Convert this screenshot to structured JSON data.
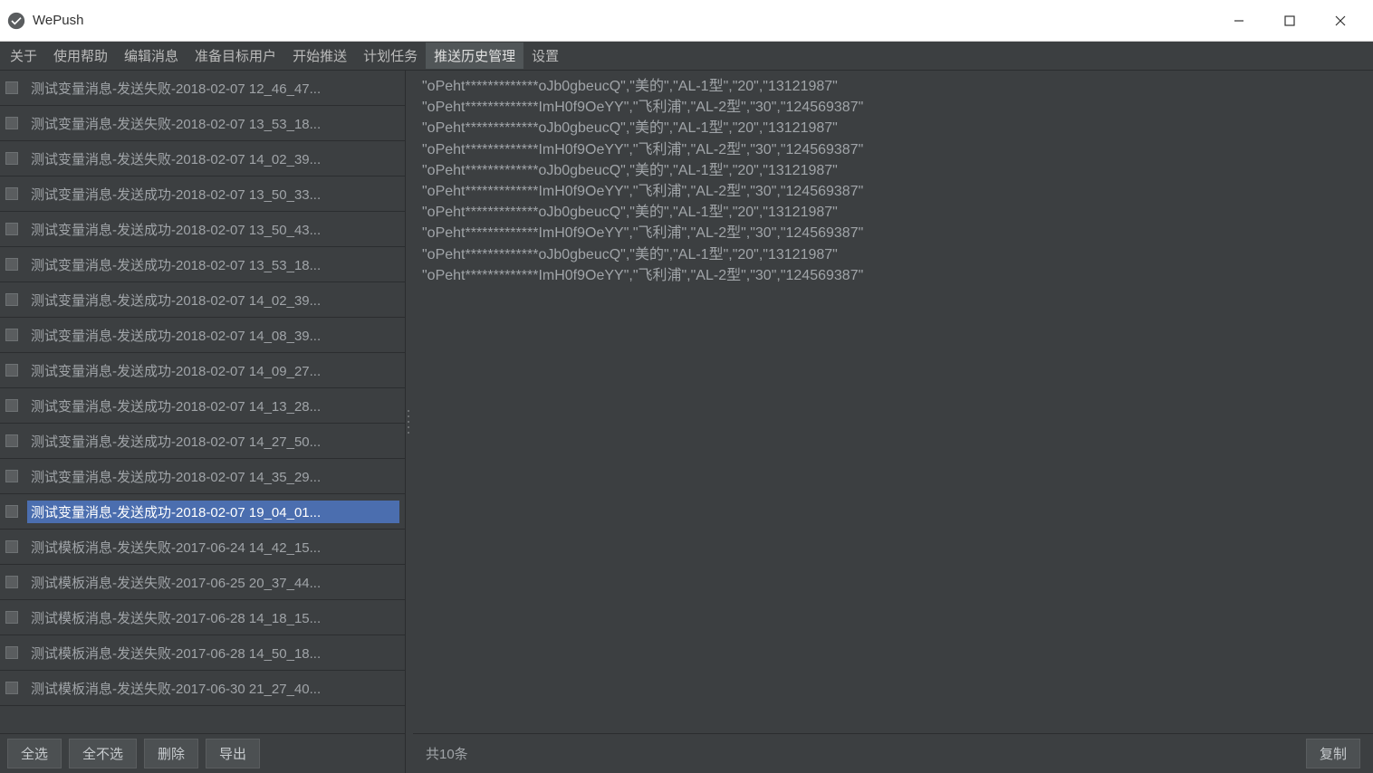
{
  "window": {
    "title": "WePush"
  },
  "menu": {
    "items": [
      {
        "label": "关于",
        "active": false
      },
      {
        "label": "使用帮助",
        "active": false
      },
      {
        "label": "编辑消息",
        "active": false
      },
      {
        "label": "准备目标用户",
        "active": false
      },
      {
        "label": "开始推送",
        "active": false
      },
      {
        "label": "计划任务",
        "active": false
      },
      {
        "label": "推送历史管理",
        "active": true
      },
      {
        "label": "设置",
        "active": false
      }
    ]
  },
  "history": {
    "items": [
      {
        "label": "测试变量消息-发送失败-2018-02-07 12_46_47...",
        "selected": false
      },
      {
        "label": "测试变量消息-发送失败-2018-02-07 13_53_18...",
        "selected": false
      },
      {
        "label": "测试变量消息-发送失败-2018-02-07 14_02_39...",
        "selected": false
      },
      {
        "label": "测试变量消息-发送成功-2018-02-07 13_50_33...",
        "selected": false
      },
      {
        "label": "测试变量消息-发送成功-2018-02-07 13_50_43...",
        "selected": false
      },
      {
        "label": "测试变量消息-发送成功-2018-02-07 13_53_18...",
        "selected": false
      },
      {
        "label": "测试变量消息-发送成功-2018-02-07 14_02_39...",
        "selected": false
      },
      {
        "label": "测试变量消息-发送成功-2018-02-07 14_08_39...",
        "selected": false
      },
      {
        "label": "测试变量消息-发送成功-2018-02-07 14_09_27...",
        "selected": false
      },
      {
        "label": "测试变量消息-发送成功-2018-02-07 14_13_28...",
        "selected": false
      },
      {
        "label": "测试变量消息-发送成功-2018-02-07 14_27_50...",
        "selected": false
      },
      {
        "label": "测试变量消息-发送成功-2018-02-07 14_35_29...",
        "selected": false
      },
      {
        "label": "测试变量消息-发送成功-2018-02-07 19_04_01...",
        "selected": true
      },
      {
        "label": "测试模板消息-发送失败-2017-06-24 14_42_15...",
        "selected": false
      },
      {
        "label": "测试模板消息-发送失败-2017-06-25 20_37_44...",
        "selected": false
      },
      {
        "label": "测试模板消息-发送失败-2017-06-28 14_18_15...",
        "selected": false
      },
      {
        "label": "测试模板消息-发送失败-2017-06-28 14_50_18...",
        "selected": false
      },
      {
        "label": "测试模板消息-发送失败-2017-06-30 21_27_40...",
        "selected": false
      }
    ]
  },
  "leftToolbar": {
    "selectAll": "全选",
    "selectNone": "全不选",
    "delete": "删除",
    "export": "导出"
  },
  "content": {
    "lines": [
      "\"oPeht*************oJb0gbeucQ\",\"美的\",\"AL-1型\",\"20\",\"13121987\"",
      "\"oPeht*************ImH0f9OeYY\",\"飞利浦\",\"AL-2型\",\"30\",\"124569387\"",
      "\"oPeht*************oJb0gbeucQ\",\"美的\",\"AL-1型\",\"20\",\"13121987\"",
      "\"oPeht*************ImH0f9OeYY\",\"飞利浦\",\"AL-2型\",\"30\",\"124569387\"",
      "\"oPeht*************oJb0gbeucQ\",\"美的\",\"AL-1型\",\"20\",\"13121987\"",
      "\"oPeht*************ImH0f9OeYY\",\"飞利浦\",\"AL-2型\",\"30\",\"124569387\"",
      "\"oPeht*************oJb0gbeucQ\",\"美的\",\"AL-1型\",\"20\",\"13121987\"",
      "\"oPeht*************ImH0f9OeYY\",\"飞利浦\",\"AL-2型\",\"30\",\"124569387\"",
      "\"oPeht*************oJb0gbeucQ\",\"美的\",\"AL-1型\",\"20\",\"13121987\"",
      "\"oPeht*************ImH0f9OeYY\",\"飞利浦\",\"AL-2型\",\"30\",\"124569387\""
    ]
  },
  "rightToolbar": {
    "status": "共10条",
    "copy": "复制"
  }
}
